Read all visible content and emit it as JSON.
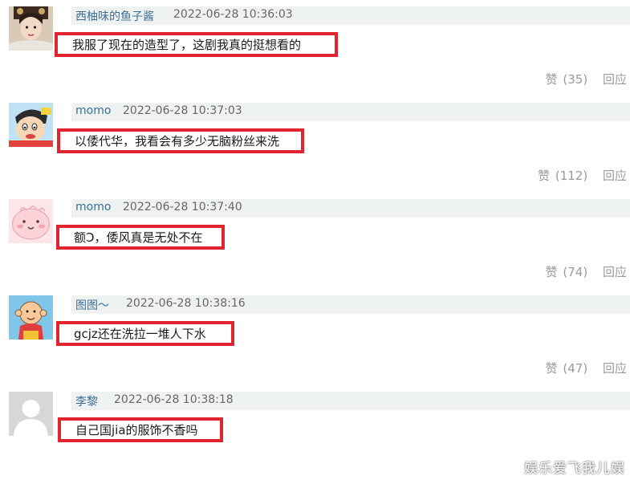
{
  "comments": [
    {
      "username": "西柚味的鱼子酱",
      "timestamp": "2022-06-28 10:36:03",
      "content": "我服了现在的造型了，这剧我真的挺想看的",
      "like_label": "赞",
      "like_count": "(35)",
      "reply_label": "回应",
      "avatar": "costume-woman-avatar"
    },
    {
      "username": "momo",
      "timestamp": "2022-06-28 10:37:03",
      "content": "以倭代华，我看会有多少无脑粉丝来洗",
      "like_label": "赞",
      "like_count": "(112)",
      "reply_label": "回应",
      "avatar": "cartoon-boy-avatar"
    },
    {
      "username": "momo",
      "timestamp": "2022-06-28 10:37:40",
      "content": "额Ↄ，倭风真是无处不在",
      "like_label": "赞",
      "like_count": "(74)",
      "reply_label": "回应",
      "avatar": "pink-blob-avatar"
    },
    {
      "username": "图图～",
      "timestamp": "2022-06-28 10:38:16",
      "content": "gcjz还在洗拉一堆人下水",
      "like_label": "赞",
      "like_count": "(47)",
      "reply_label": "回应",
      "avatar": "cartoon-kid-avatar"
    },
    {
      "username": "李黎",
      "timestamp": "2022-06-28 10:38:18",
      "content": "自己国jia的服饰不香吗",
      "avatar": "default-user-avatar"
    }
  ],
  "watermark": "娱乐爱飞我儿娱",
  "colors": {
    "highlight_border": "#e0252f",
    "username": "#3d6e96",
    "meta_bar": "#eef3f2",
    "action_text": "#9a9a9a"
  }
}
